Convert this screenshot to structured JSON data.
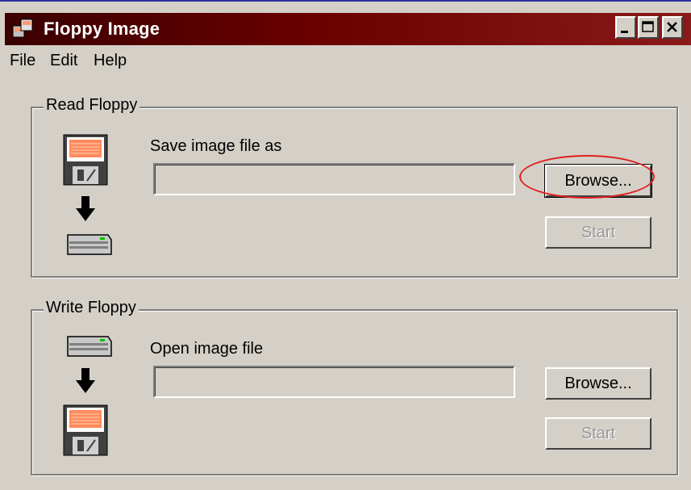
{
  "window": {
    "title": "Floppy Image",
    "accent": "#6a0000"
  },
  "menu": {
    "items": [
      "File",
      "Edit",
      "Help"
    ]
  },
  "read_floppy": {
    "group_label": "Read Floppy",
    "field_label": "Save image file as",
    "field_value": "",
    "browse_label": "Browse...",
    "start_label": "Start",
    "icons": [
      "floppy-disk-icon",
      "arrow-down-icon",
      "drive-icon"
    ]
  },
  "write_floppy": {
    "group_label": "Write Floppy",
    "field_label": "Open image file",
    "field_value": "",
    "browse_label": "Browse...",
    "start_label": "Start",
    "icons": [
      "drive-icon",
      "arrow-down-icon",
      "floppy-disk-icon"
    ]
  },
  "annotation": {
    "highlight_color": "#e02020"
  }
}
